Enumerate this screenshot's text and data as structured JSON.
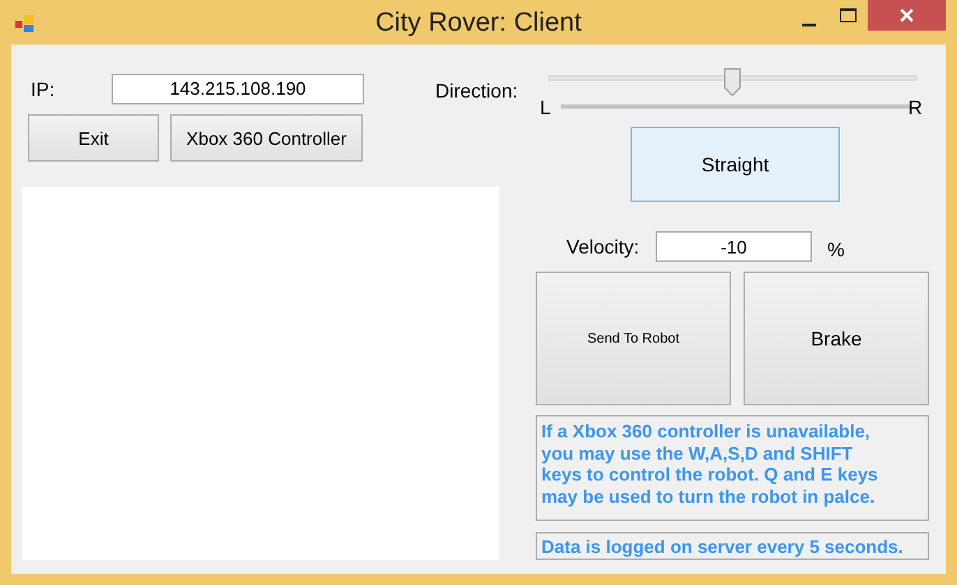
{
  "window": {
    "title": "City Rover: Client"
  },
  "ip": {
    "label": "IP:",
    "value": "143.215.108.190"
  },
  "buttons": [
    "Exit",
    "Xbox 360 Controller"
  ],
  "direction": {
    "label": "Direction:",
    "level": 0.5,
    "left_label": "L",
    "right_label": "R"
  },
  "straight_button": "Straight",
  "velocity": {
    "label": "Velocity:",
    "value": "-10",
    "unit": "%"
  },
  "send_button": "Send To Robot",
  "brake_button": "Brake",
  "help_text": "If a Xbox 360 controller is unavailable, you may use the W,A,S,D and SHIFT keys to control the robot. Q and E keys may be used to turn the robot in palce.",
  "log_text": "Data is logged on server every 5 seconds."
}
